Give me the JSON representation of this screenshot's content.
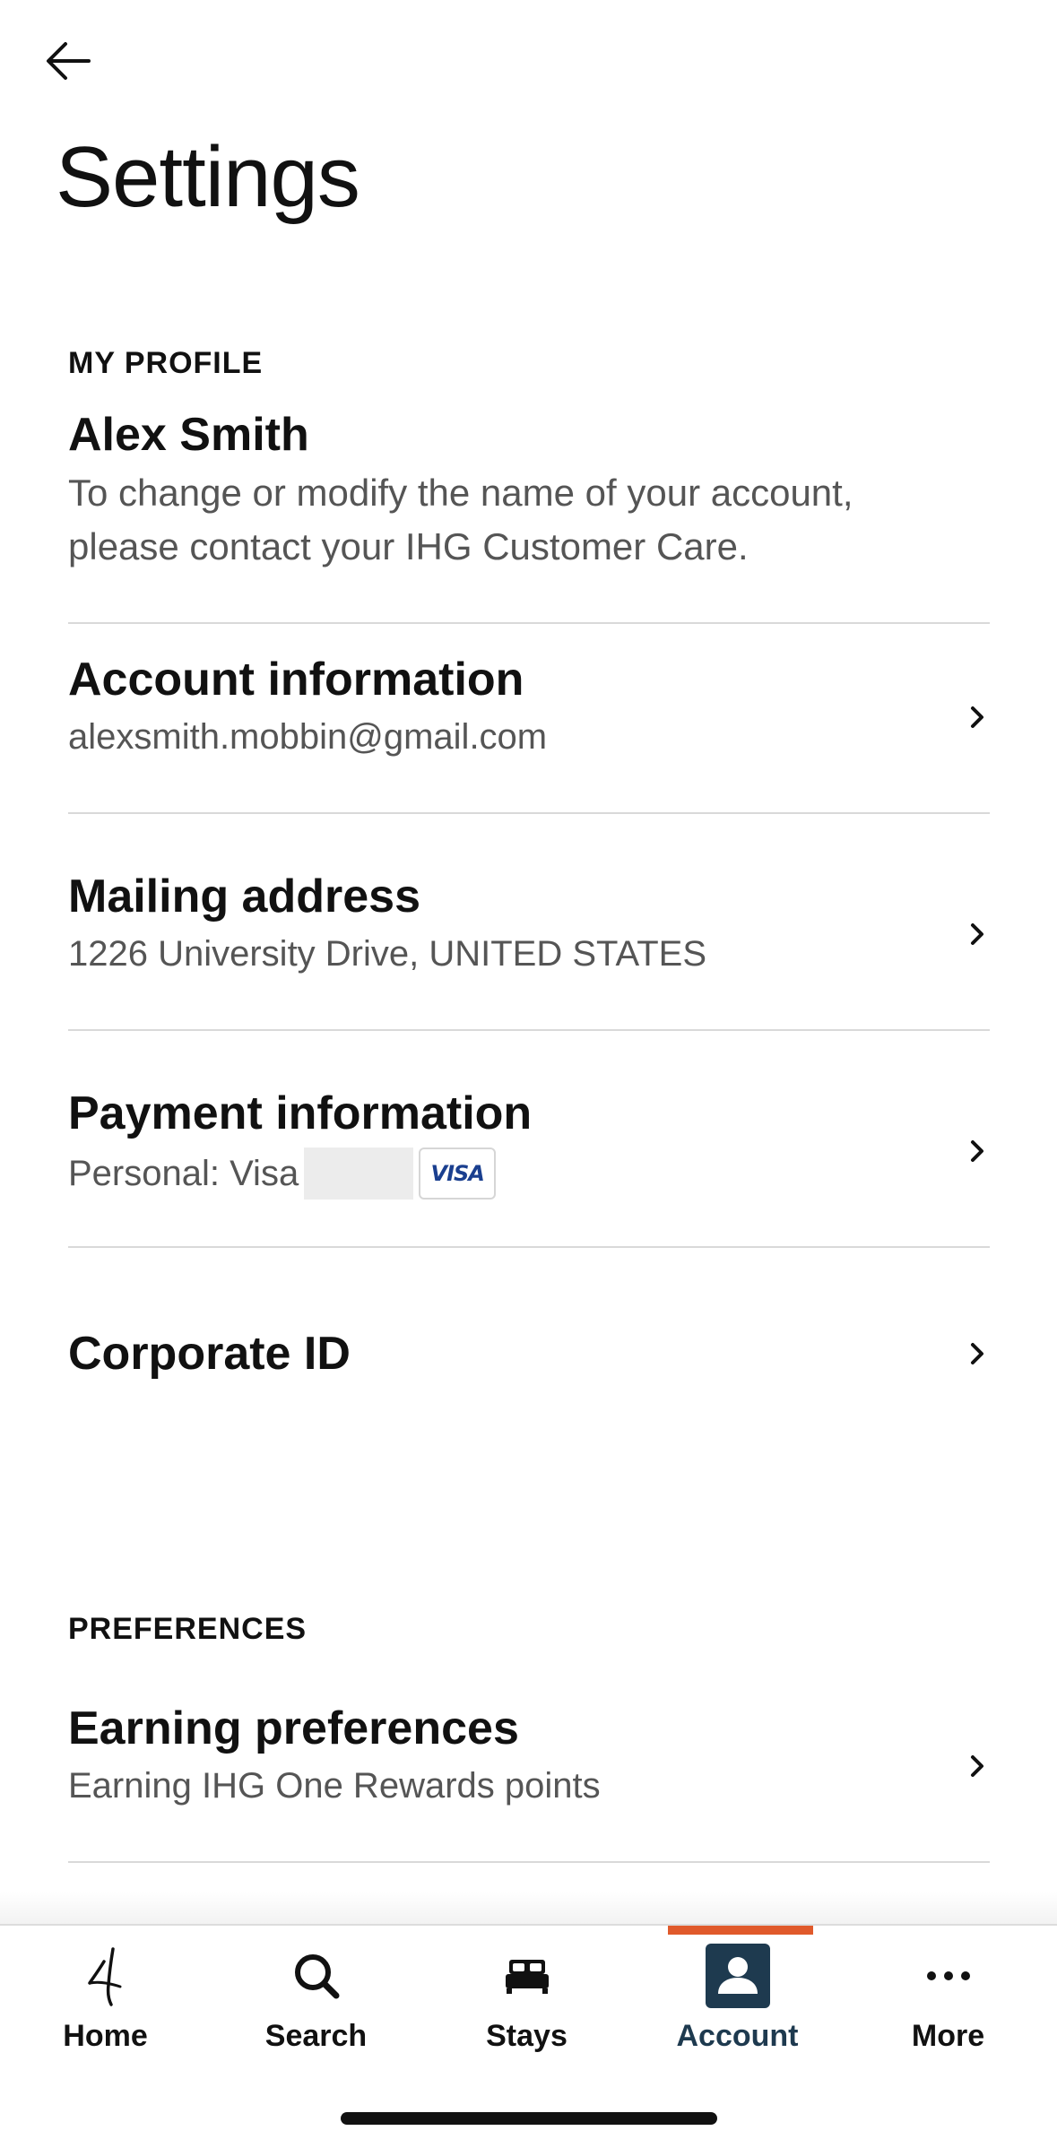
{
  "page": {
    "title": "Settings"
  },
  "profile": {
    "section": "MY PROFILE",
    "name": "Alex Smith",
    "note": "To change or modify the name of your account, please contact your IHG Customer Care."
  },
  "rows": {
    "account": {
      "title": "Account information",
      "sub": "alexsmith.mobbin@gmail.com"
    },
    "mailing": {
      "title": "Mailing address",
      "sub": "1226 University Drive, UNITED STATES"
    },
    "payment": {
      "title": "Payment information",
      "sub": "Personal: Visa",
      "card_brand": "VISA"
    },
    "corporate": {
      "title": "Corporate ID"
    }
  },
  "preferences": {
    "section": "PREFERENCES",
    "earning": {
      "title": "Earning preferences",
      "sub": "Earning IHG One Rewards points"
    }
  },
  "tabs": [
    {
      "label": "Home",
      "icon": "ihg-logo-icon"
    },
    {
      "label": "Search",
      "icon": "search-icon"
    },
    {
      "label": "Stays",
      "icon": "bed-icon"
    },
    {
      "label": "Account",
      "icon": "account-icon",
      "active": true
    },
    {
      "label": "More",
      "icon": "more-icon"
    }
  ],
  "colors": {
    "accent": "#e05a2b",
    "account_tab": "#1e3a4f",
    "visa": "#1a3f8f"
  }
}
